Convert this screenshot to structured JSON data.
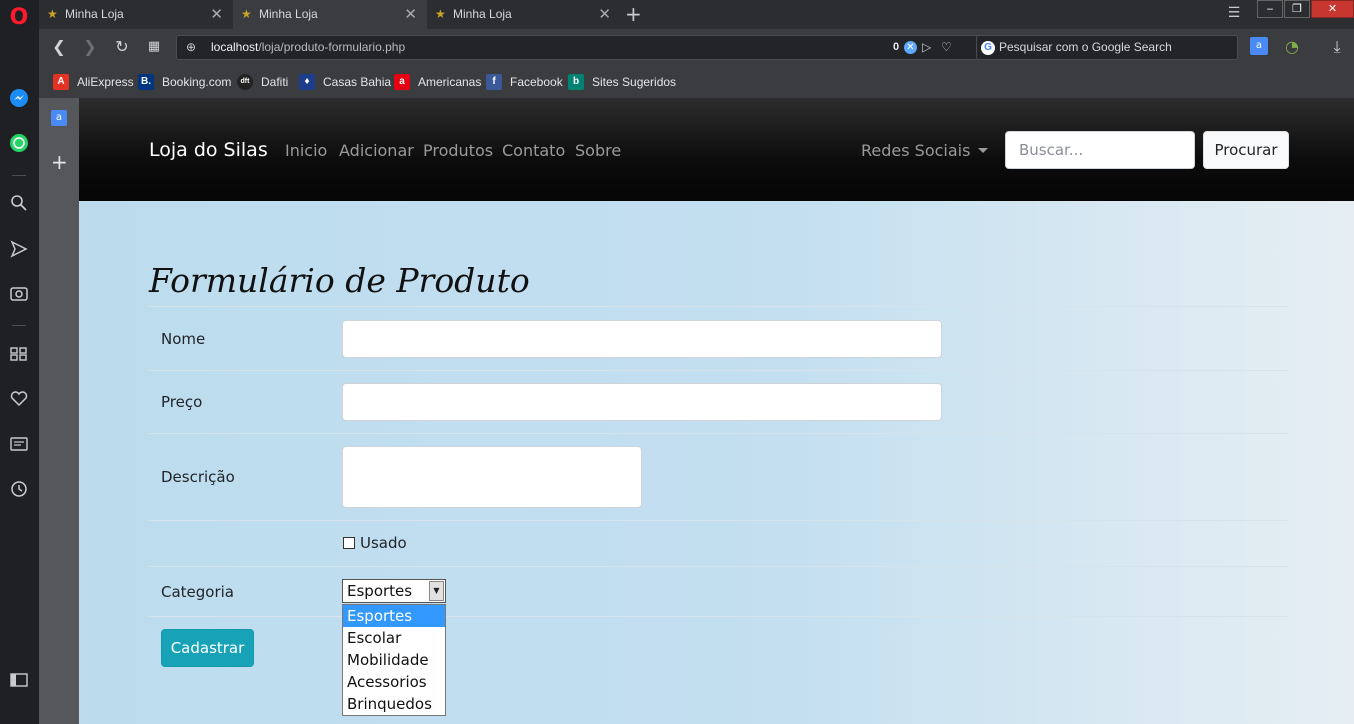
{
  "browser": {
    "tabs": [
      {
        "title": "Minha Loja"
      },
      {
        "title": "Minha Loja"
      },
      {
        "title": "Minha Loja"
      }
    ],
    "url_host": "localhost",
    "url_path": "/loja/produto-formulario.php",
    "tracker_count": "0",
    "search_placeholder": "Pesquisar com o Google Search",
    "bookmarks": [
      {
        "label": "AliExpress",
        "icon": "aliexpress-icon",
        "color": "#e43225"
      },
      {
        "label": "Booking.com",
        "icon": "booking-icon",
        "color": "#003580"
      },
      {
        "label": "Dafiti",
        "icon": "dafiti-icon",
        "color": "#222222"
      },
      {
        "label": "Casas Bahia",
        "icon": "casas-bahia-icon",
        "color": "#1c3c8c"
      },
      {
        "label": "Americanas",
        "icon": "americanas-icon",
        "color": "#e60014"
      },
      {
        "label": "Facebook",
        "icon": "facebook-icon",
        "color": "#3b5998"
      },
      {
        "label": "Sites Sugeridos",
        "icon": "bing-icon",
        "color": "#008373"
      }
    ]
  },
  "navbar": {
    "brand": "Loja do Silas",
    "links": [
      "Inicio",
      "Adicionar",
      "Produtos",
      "Contato",
      "Sobre"
    ],
    "dropdown": "Redes Sociais",
    "search_placeholder": "Buscar...",
    "search_button": "Procurar"
  },
  "form": {
    "title": "Formulário de Produto",
    "labels": {
      "nome": "Nome",
      "preco": "Preço",
      "descricao": "Descrição",
      "usado": "Usado",
      "categoria": "Categoria"
    },
    "categoria_selected": "Esportes",
    "categoria_options": [
      "Esportes",
      "Escolar",
      "Mobilidade",
      "Acessorios",
      "Brinquedos"
    ],
    "submit": "Cadastrar"
  },
  "colors": {
    "accent_button": "#17a2b8",
    "selected_option": "#3399ff"
  }
}
